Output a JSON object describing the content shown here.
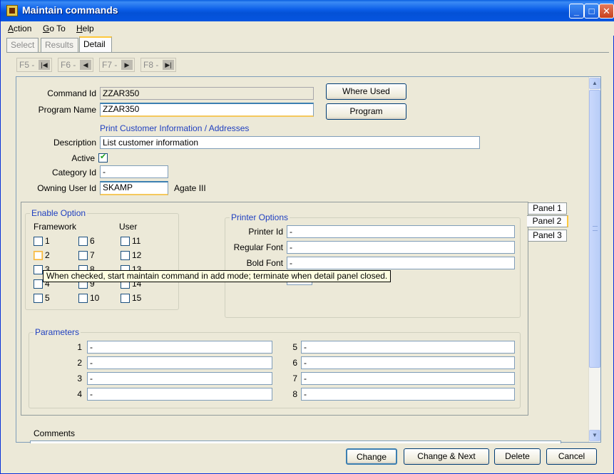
{
  "window": {
    "title": "Maintain commands"
  },
  "menu": {
    "items": [
      "Action",
      "Go To",
      "Help"
    ]
  },
  "tabs": [
    "Select",
    "Results",
    "Detail"
  ],
  "nav": [
    {
      "label": "F5 -",
      "icon": "first-record-icon",
      "glyph": "|◀"
    },
    {
      "label": "F6 -",
      "icon": "prev-record-icon",
      "glyph": "◀"
    },
    {
      "label": "F7 -",
      "icon": "next-record-icon",
      "glyph": "▶"
    },
    {
      "label": "F8 -",
      "icon": "last-record-icon",
      "glyph": "▶|"
    }
  ],
  "form": {
    "command_id_label": "Command Id",
    "command_id": "ZZAR350",
    "program_name_label": "Program Name",
    "program_name": "ZZAR350",
    "program_description": "Print Customer Information / Addresses",
    "description_label": "Description",
    "description": "List customer information",
    "active_label": "Active",
    "active": true,
    "category_label": "Category Id",
    "category": "-",
    "owner_label": "Owning User Id",
    "owner": "SKAMP",
    "owner_name": "Agate III",
    "where_used_label": "Where Used",
    "program_button_label": "Program"
  },
  "enable_option": {
    "title": "Enable Option",
    "framework_label": "Framework",
    "user_label": "User",
    "col1": [
      "1",
      "2",
      "3",
      "4",
      "5"
    ],
    "col2": [
      "6",
      "7",
      "8",
      "9",
      "10"
    ],
    "col3": [
      "11",
      "12",
      "13",
      "14",
      "15"
    ]
  },
  "printer": {
    "title": "Printer Options",
    "printer_id_label": "Printer Id",
    "printer_id": "-",
    "regular_font_label": "Regular Font",
    "regular_font": "-",
    "bold_font_label": "Bold Font",
    "bold_font": "-"
  },
  "tooltip": "When checked, start maintain command in add mode; terminate when detail panel closed.",
  "panel_tabs": [
    "Panel 1",
    "Panel 2",
    "Panel 3"
  ],
  "parameters": {
    "title": "Parameters",
    "labels": [
      "1",
      "2",
      "3",
      "4",
      "5",
      "6",
      "7",
      "8"
    ],
    "values": [
      "-",
      "-",
      "-",
      "-",
      "-",
      "-",
      "-",
      "-"
    ]
  },
  "comments_label": "Comments",
  "buttons": {
    "change": "Change",
    "change_next": "Change & Next",
    "delete": "Delete",
    "cancel": "Cancel"
  }
}
